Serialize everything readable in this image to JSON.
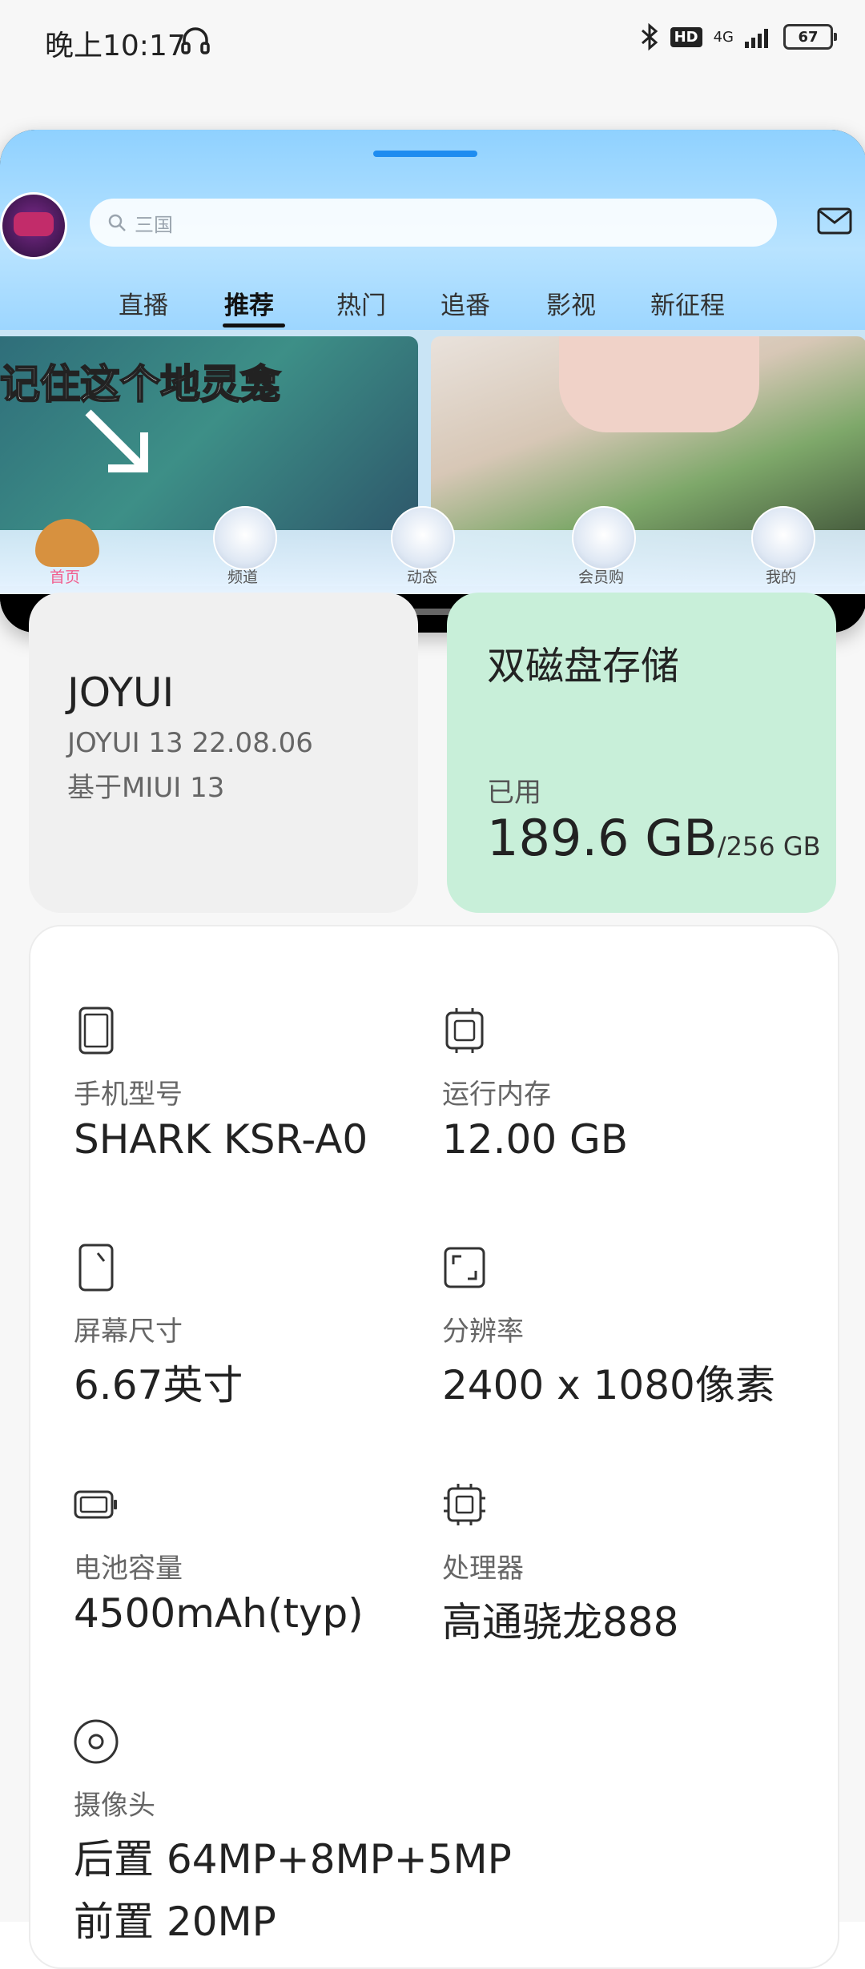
{
  "status": {
    "time": "晚上10:17",
    "hd_badge": "HD",
    "network": "4G",
    "battery": "67"
  },
  "float_window": {
    "search": {
      "placeholder": "三国"
    },
    "tabs": [
      "直播",
      "推荐",
      "热门",
      "追番",
      "影视",
      "新征程"
    ],
    "active_tab": "推荐",
    "video_card_1": {
      "overlay_text": "记住这个地灵龛"
    },
    "bottom_nav": {
      "items": [
        "首页",
        "频道",
        "动态",
        "会员购",
        "我的"
      ],
      "active": "首页"
    }
  },
  "system_card": {
    "title": "JOYUI",
    "version": "JOYUI 13 22.08.06",
    "base": "基于MIUI 13"
  },
  "storage_card": {
    "title": "双磁盘存储",
    "used_label": "已用",
    "used_value": "189.6 GB",
    "total": "/256 GB"
  },
  "specs": {
    "model": {
      "label": "手机型号",
      "value": "SHARK KSR-A0",
      "icon": "phone-icon"
    },
    "ram": {
      "label": "运行内存",
      "value": "12.00 GB",
      "icon": "memory-chip-icon"
    },
    "screen": {
      "label": "屏幕尺寸",
      "value": "6.67英寸",
      "icon": "screen-size-icon"
    },
    "resolution": {
      "label": "分辨率",
      "value": "2400 x 1080像素",
      "icon": "resolution-icon"
    },
    "battery": {
      "label": "电池容量",
      "value": "4500mAh(typ)",
      "icon": "battery-icon"
    },
    "cpu": {
      "label": "处理器",
      "value": "高通骁龙888",
      "icon": "processor-icon"
    },
    "camera": {
      "label": "摄像头",
      "rear": "后置 64MP+8MP+5MP",
      "front": "前置 20MP",
      "icon": "camera-icon"
    }
  }
}
